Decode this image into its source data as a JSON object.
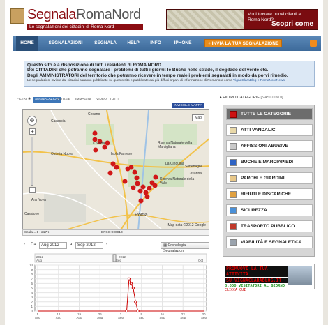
{
  "header": {
    "logo_title_a": "Segnala",
    "logo_title_b": "RomaNord",
    "logo_subtitle": "Le segnalazioni dei cittadini di Roma Nord",
    "banner_question": "Vuoi trovare nuovi clienti a Roma Nord?",
    "banner_cta": "Scopri come"
  },
  "nav": {
    "items": [
      "HOME",
      "SEGNALAZIONI",
      "SEGNALA",
      "HELP",
      "INFO",
      "IPHONE"
    ],
    "cta": "INVIA LA TUA SEGNALAZIONE"
  },
  "notice": {
    "line1": "Questo sito è a disposizione di tutti i residenti di ROMA NORD",
    "line2": "Dei CITTADINI che potranno segnalare i problemi di tutti i giorni: le Buche nelle strade, il degdado del verde etc.",
    "line3": "Degli AMMINISTRATORI del territorio che potranno ricevere in tempo reale i problemi segnalati in modo da porvi rimedio.",
    "small": "Le segnalazioni inviate dai cittadini saranno pubblicate su questo sito e pubblicate dai più diffusi organi di Informazione di Romanord come",
    "small_link": "VignaClaraBlog e RomaNordNews"
  },
  "filters": {
    "label": "FILTRI",
    "tabs": [
      "SEGNALAZIONI",
      "NOTIZIE",
      "IMMAGINI",
      "VIDEO",
      "TUTTI"
    ],
    "invisible": "INVISIBLE MAPPA"
  },
  "map": {
    "type_label": "Map",
    "labels": [
      "Casaccia",
      "Cesano",
      "Isola Farnese",
      "La Storta",
      "Osteria Nuova",
      "Riserva Naturale della Marcigliana",
      "La Cinquina",
      "Settebagni",
      "Cesarina",
      "Riserva Naturale della Valle",
      "Ara Nova",
      "Roma",
      "Casalone"
    ],
    "scale": "Scala = 1 : 217K",
    "epsg": "EPSG:900913",
    "credit": "Map data ©2012 Google"
  },
  "dates": {
    "da": "Da",
    "from": "Aug 2012",
    "a": "a",
    "to": "Sep 2012",
    "cron_button": "Cronologia Segnalazioni"
  },
  "chart_data": {
    "type": "line",
    "year_label": "2012",
    "x": [
      "5 Aug",
      "12 Aug",
      "19 Aug",
      "26 Aug",
      "2 Sep",
      "9 Sep",
      "16 Sep",
      "23 Sep",
      "30 Sep"
    ],
    "series": [
      {
        "name": "",
        "values": [
          0,
          0,
          0,
          0,
          0,
          0,
          0,
          0,
          0
        ]
      },
      {
        "name": "",
        "points": [
          [
            30.0,
            0
          ],
          [
            30.8,
            7
          ],
          [
            31.5,
            6
          ],
          [
            32.2,
            5
          ],
          [
            33.0,
            2
          ],
          [
            33.8,
            0
          ]
        ]
      }
    ],
    "y_ticks": [
      0,
      1,
      2,
      3,
      4,
      5,
      6,
      7,
      8,
      9,
      10
    ],
    "ylim": [
      0,
      10
    ],
    "top_axis": [
      "2012",
      "Aug",
      "Sep",
      "Oct"
    ],
    "grid": true
  },
  "sidebar": {
    "title": "FILTRO CATEGORIE",
    "none_label": "[NASCONDI]",
    "categories": [
      "TUTTE LE CATEGORIE",
      "ATTI VANDALICI",
      "AFFISSIONI ABUSIVE",
      "BUCHE E MARCIAPIEDI",
      "PARCHI E GIARDINI",
      "RIFIUTI E DISCARICHE",
      "SICUREZZA",
      "TRASPORTO PUBBLICO",
      "VIABILITÀ E SEGNALETICA"
    ]
  },
  "promo": {
    "line1": "PROMUOVI LA TUA ATTIVITÀ",
    "line2": "SU VIGNACLARABLOG.IT",
    "line3": "3.000 VISITATORI AL GIORNO",
    "line4": "CLICCA QUI"
  }
}
